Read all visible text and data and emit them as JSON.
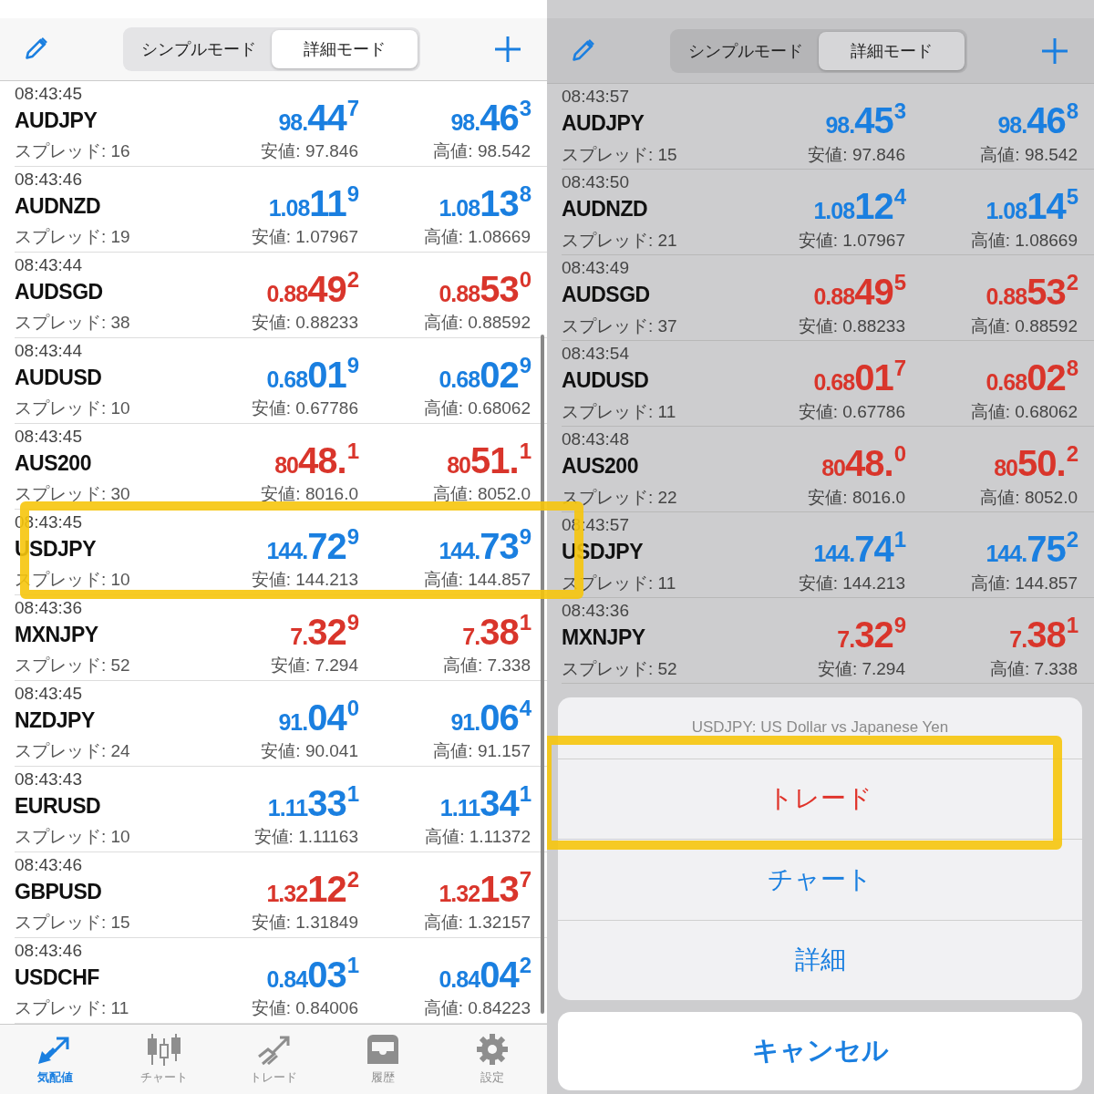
{
  "left": {
    "segments": [
      {
        "label": "シンプルモード",
        "selected": false
      },
      {
        "label": "詳細モード",
        "selected": true
      }
    ],
    "rows": [
      {
        "time": "08:43:45",
        "name": "AUDJPY",
        "spread": "スプレッド: 16",
        "color": "#1a7fe0",
        "highlighted": false,
        "bid": {
          "prefix": "98.",
          "main": "44",
          "pip": "7"
        },
        "ask": {
          "prefix": "98.",
          "main": "46",
          "pip": "3"
        },
        "low": "安値: 97.846",
        "high": "高値: 98.542"
      },
      {
        "time": "08:43:46",
        "name": "AUDNZD",
        "spread": "スプレッド: 19",
        "color": "#1a7fe0",
        "highlighted": false,
        "bid": {
          "prefix": "1.08",
          "main": "11",
          "pip": "9"
        },
        "ask": {
          "prefix": "1.08",
          "main": "13",
          "pip": "8"
        },
        "low": "安値: 1.07967",
        "high": "高値: 1.08669"
      },
      {
        "time": "08:43:44",
        "name": "AUDSGD",
        "spread": "スプレッド: 38",
        "color": "#d9352b",
        "highlighted": false,
        "bid": {
          "prefix": "0.88",
          "main": "49",
          "pip": "2"
        },
        "ask": {
          "prefix": "0.88",
          "main": "53",
          "pip": "0"
        },
        "low": "安値: 0.88233",
        "high": "高値: 0.88592"
      },
      {
        "time": "08:43:44",
        "name": "AUDUSD",
        "spread": "スプレッド: 10",
        "color": "#1a7fe0",
        "highlighted": false,
        "bid": {
          "prefix": "0.68",
          "main": "01",
          "pip": "9"
        },
        "ask": {
          "prefix": "0.68",
          "main": "02",
          "pip": "9"
        },
        "low": "安値: 0.67786",
        "high": "高値: 0.68062"
      },
      {
        "time": "08:43:45",
        "name": "AUS200",
        "spread": "スプレッド: 30",
        "color": "#d9352b",
        "highlighted": false,
        "bid": {
          "prefix": "80",
          "main": "48.",
          "pip": "1"
        },
        "ask": {
          "prefix": "80",
          "main": "51.",
          "pip": "1"
        },
        "low": "安値: 8016.0",
        "high": "高値: 8052.0"
      },
      {
        "time": "08:43:45",
        "name": "USDJPY",
        "spread": "スプレッド: 10",
        "color": "#1a7fe0",
        "highlighted": true,
        "bid": {
          "prefix": "144.",
          "main": "72",
          "pip": "9"
        },
        "ask": {
          "prefix": "144.",
          "main": "73",
          "pip": "9"
        },
        "low": "安値: 144.213",
        "high": "高値: 144.857"
      },
      {
        "time": "08:43:36",
        "name": "MXNJPY",
        "spread": "スプレッド: 52",
        "color": "#d9352b",
        "highlighted": false,
        "bid": {
          "prefix": "7.",
          "main": "32",
          "pip": "9"
        },
        "ask": {
          "prefix": "7.",
          "main": "38",
          "pip": "1"
        },
        "low": "安値: 7.294",
        "high": "高値: 7.338"
      },
      {
        "time": "08:43:45",
        "name": "NZDJPY",
        "spread": "スプレッド: 24",
        "color": "#1a7fe0",
        "highlighted": false,
        "bid": {
          "prefix": "91.",
          "main": "04",
          "pip": "0"
        },
        "ask": {
          "prefix": "91.",
          "main": "06",
          "pip": "4"
        },
        "low": "安値: 90.041",
        "high": "高値: 91.157"
      },
      {
        "time": "08:43:43",
        "name": "EURUSD",
        "spread": "スプレッド: 10",
        "color": "#1a7fe0",
        "highlighted": false,
        "bid": {
          "prefix": "1.11",
          "main": "33",
          "pip": "1"
        },
        "ask": {
          "prefix": "1.11",
          "main": "34",
          "pip": "1"
        },
        "low": "安値: 1.11163",
        "high": "高値: 1.11372"
      },
      {
        "time": "08:43:46",
        "name": "GBPUSD",
        "spread": "スプレッド: 15",
        "color": "#d9352b",
        "highlighted": false,
        "bid": {
          "prefix": "1.32",
          "main": "12",
          "pip": "2"
        },
        "ask": {
          "prefix": "1.32",
          "main": "13",
          "pip": "7"
        },
        "low": "安値: 1.31849",
        "high": "高値: 1.32157"
      },
      {
        "time": "08:43:46",
        "name": "USDCHF",
        "spread": "スプレッド: 11",
        "color": "#1a7fe0",
        "highlighted": false,
        "bid": {
          "prefix": "0.84",
          "main": "03",
          "pip": "1"
        },
        "ask": {
          "prefix": "0.84",
          "main": "04",
          "pip": "2"
        },
        "low": "安値: 0.84006",
        "high": "高値: 0.84223"
      }
    ],
    "tab_bar": [
      {
        "label": "気配値",
        "selected": true
      },
      {
        "label": "チャート",
        "selected": false
      },
      {
        "label": "トレード",
        "selected": false
      },
      {
        "label": "履歴",
        "selected": false
      },
      {
        "label": "設定",
        "selected": false
      }
    ]
  },
  "right": {
    "segments": [
      {
        "label": "シンプルモード",
        "selected": false
      },
      {
        "label": "詳細モード",
        "selected": true
      }
    ],
    "rows": [
      {
        "time": "08:43:57",
        "name": "AUDJPY",
        "spread": "スプレッド: 15",
        "color": "#1a7fe0",
        "highlighted": false,
        "bid": {
          "prefix": "98.",
          "main": "45",
          "pip": "3"
        },
        "ask": {
          "prefix": "98.",
          "main": "46",
          "pip": "8"
        },
        "low": "安値: 97.846",
        "high": "高値: 98.542"
      },
      {
        "time": "08:43:50",
        "name": "AUDNZD",
        "spread": "スプレッド: 21",
        "color": "#1a7fe0",
        "highlighted": false,
        "bid": {
          "prefix": "1.08",
          "main": "12",
          "pip": "4"
        },
        "ask": {
          "prefix": "1.08",
          "main": "14",
          "pip": "5"
        },
        "low": "安値: 1.07967",
        "high": "高値: 1.08669"
      },
      {
        "time": "08:43:49",
        "name": "AUDSGD",
        "spread": "スプレッド: 37",
        "color": "#d9352b",
        "highlighted": false,
        "bid": {
          "prefix": "0.88",
          "main": "49",
          "pip": "5"
        },
        "ask": {
          "prefix": "0.88",
          "main": "53",
          "pip": "2"
        },
        "low": "安値: 0.88233",
        "high": "高値: 0.88592"
      },
      {
        "time": "08:43:54",
        "name": "AUDUSD",
        "spread": "スプレッド: 11",
        "color": "#d9352b",
        "highlighted": false,
        "bid": {
          "prefix": "0.68",
          "main": "01",
          "pip": "7"
        },
        "ask": {
          "prefix": "0.68",
          "main": "02",
          "pip": "8"
        },
        "low": "安値: 0.67786",
        "high": "高値: 0.68062"
      },
      {
        "time": "08:43:48",
        "name": "AUS200",
        "spread": "スプレッド: 22",
        "color": "#d9352b",
        "highlighted": false,
        "bid": {
          "prefix": "80",
          "main": "48.",
          "pip": "0"
        },
        "ask": {
          "prefix": "80",
          "main": "50.",
          "pip": "2"
        },
        "low": "安値: 8016.0",
        "high": "高値: 8052.0"
      },
      {
        "time": "08:43:57",
        "name": "USDJPY",
        "spread": "スプレッド: 11",
        "color": "#1a7fe0",
        "highlighted": false,
        "bid": {
          "prefix": "144.",
          "main": "74",
          "pip": "1"
        },
        "ask": {
          "prefix": "144.",
          "main": "75",
          "pip": "2"
        },
        "low": "安値: 144.213",
        "high": "高値: 144.857"
      },
      {
        "time": "08:43:36",
        "name": "MXNJPY",
        "spread": "スプレッド: 52",
        "color": "#d9352b",
        "highlighted": false,
        "bid": {
          "prefix": "7.",
          "main": "32",
          "pip": "9"
        },
        "ask": {
          "prefix": "7.",
          "main": "38",
          "pip": "1"
        },
        "low": "安値: 7.294",
        "high": "高値: 7.338"
      }
    ],
    "action_sheet": {
      "title": "USDJPY: US Dollar vs Japanese Yen",
      "actions": [
        {
          "label": "トレード",
          "kind": "destructive",
          "highlighted": true
        },
        {
          "label": "チャート",
          "kind": "default",
          "highlighted": false
        },
        {
          "label": "詳細",
          "kind": "default",
          "highlighted": false
        }
      ],
      "cancel": "キャンセル"
    }
  }
}
